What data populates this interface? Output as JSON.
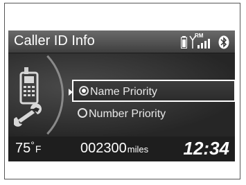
{
  "header": {
    "title": "Caller ID Info",
    "status_icons": [
      "battery-icon",
      "signal-icon",
      "roaming-icon",
      "bluetooth-icon"
    ],
    "roaming_label": "RM"
  },
  "menu": {
    "options": [
      {
        "label": "Name Priority",
        "selected": true
      },
      {
        "label": "Number Priority",
        "selected": false
      }
    ]
  },
  "footer": {
    "temperature": "75",
    "temperature_degree": "°",
    "temperature_unit": "F",
    "odometer": "002300",
    "odometer_unit": "miles",
    "clock": "12:34"
  },
  "colors": {
    "screen_bg": "#2b2b2b",
    "header_bg": "#505050",
    "text": "#ffffff"
  }
}
